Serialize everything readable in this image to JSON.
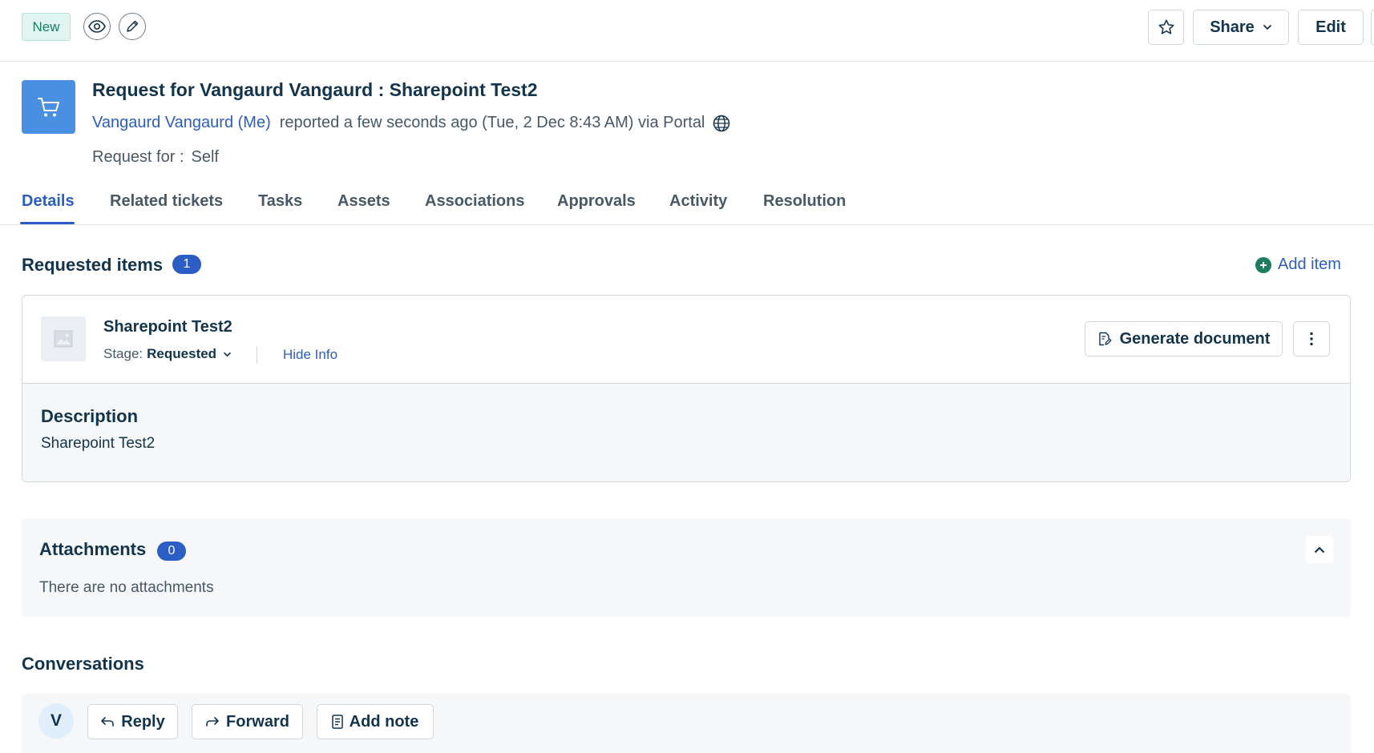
{
  "header": {
    "status_badge": "New",
    "share_label": "Share",
    "edit_label": "Edit"
  },
  "ticket": {
    "title": "Request for Vangaurd Vangaurd : Sharepoint Test2",
    "requester": "Vangaurd Vangaurd (Me)",
    "reported_text": "reported a few seconds ago (Tue, 2 Dec 8:43 AM) via Portal",
    "request_for_label": "Request for :",
    "request_for_value": "Self"
  },
  "tabs": [
    {
      "label": "Details",
      "active": true
    },
    {
      "label": "Related tickets"
    },
    {
      "label": "Tasks"
    },
    {
      "label": "Assets"
    },
    {
      "label": "Associations"
    },
    {
      "label": "Approvals"
    },
    {
      "label": "Activity"
    },
    {
      "label": "Resolution"
    }
  ],
  "requested_items": {
    "title": "Requested items",
    "count": "1",
    "add_label": "Add item",
    "item": {
      "name": "Sharepoint Test2",
      "stage_label": "Stage:",
      "stage_value": "Requested",
      "hide_info": "Hide Info",
      "generate_label": "Generate document",
      "description_title": "Description",
      "description_text": "Sharepoint Test2"
    }
  },
  "attachments": {
    "title": "Attachments",
    "count": "0",
    "empty_text": "There are no attachments"
  },
  "conversations": {
    "title": "Conversations",
    "avatar_initial": "V",
    "reply_label": "Reply",
    "forward_label": "Forward",
    "add_note_label": "Add note"
  },
  "colors": {
    "accent": "#2c5cc5",
    "ticket_icon_bg": "#4a90e2",
    "badge_new_bg": "#e0f5ef",
    "add_item_plus": "#1b7f5f"
  },
  "icons": [
    "eye-icon",
    "pencil-icon",
    "star-icon",
    "chevron-down-icon",
    "cart-icon",
    "globe-icon",
    "plus-circle-icon",
    "image-placeholder-icon",
    "document-icon",
    "kebab-icon",
    "chevron-up-icon",
    "reply-icon",
    "forward-icon",
    "note-icon"
  ]
}
